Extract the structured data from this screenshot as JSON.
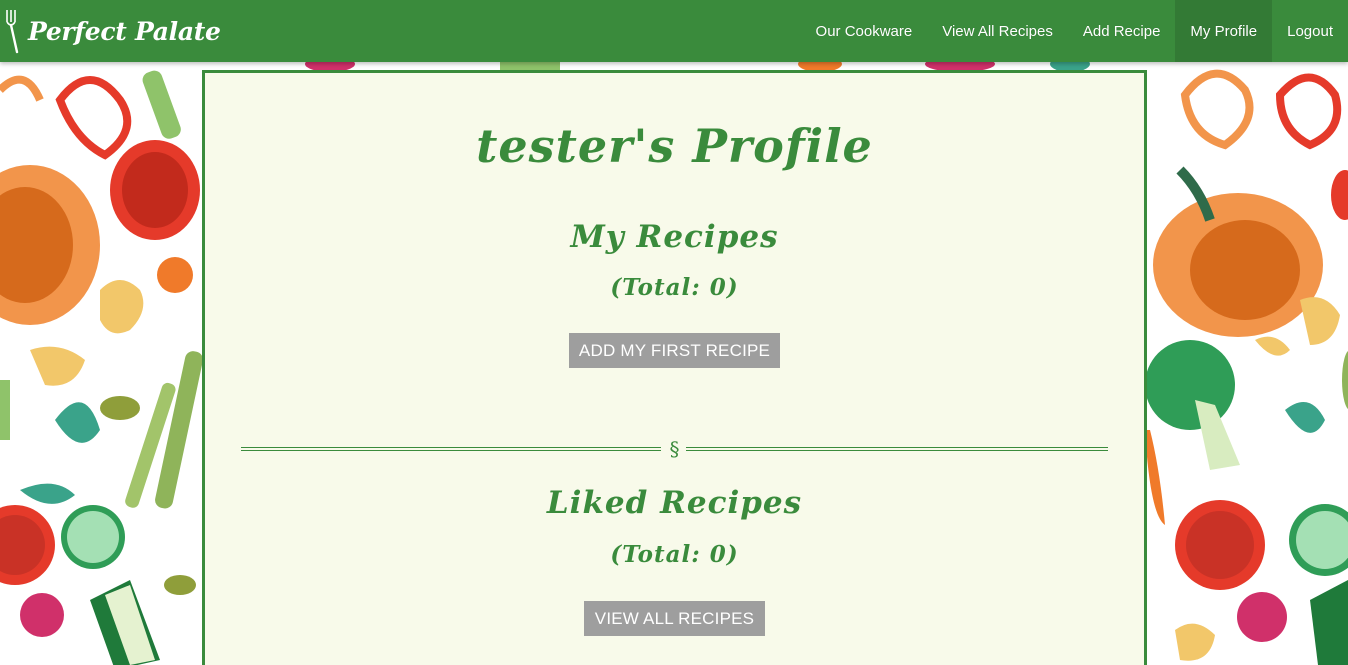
{
  "brand": {
    "name": "Perfect Palate",
    "icon": "fork-icon"
  },
  "nav": {
    "items": [
      {
        "label": "Our Cookware"
      },
      {
        "label": "View All Recipes"
      },
      {
        "label": "Add Recipe"
      },
      {
        "label": "My Profile",
        "active": true
      },
      {
        "label": "Logout"
      }
    ]
  },
  "profile": {
    "title": "tester's Profile",
    "my_recipes": {
      "heading": "My Recipes",
      "total": "(Total: 0)",
      "button": "ADD MY FIRST RECIPE"
    },
    "divider_mark": "§",
    "liked_recipes": {
      "heading": "Liked Recipes",
      "total": "(Total: 0)",
      "button": "VIEW ALL RECIPES"
    }
  },
  "colors": {
    "brand_green": "#3a8b3c",
    "card_bg": "#f8faea",
    "button_gray": "#9e9e9e"
  }
}
